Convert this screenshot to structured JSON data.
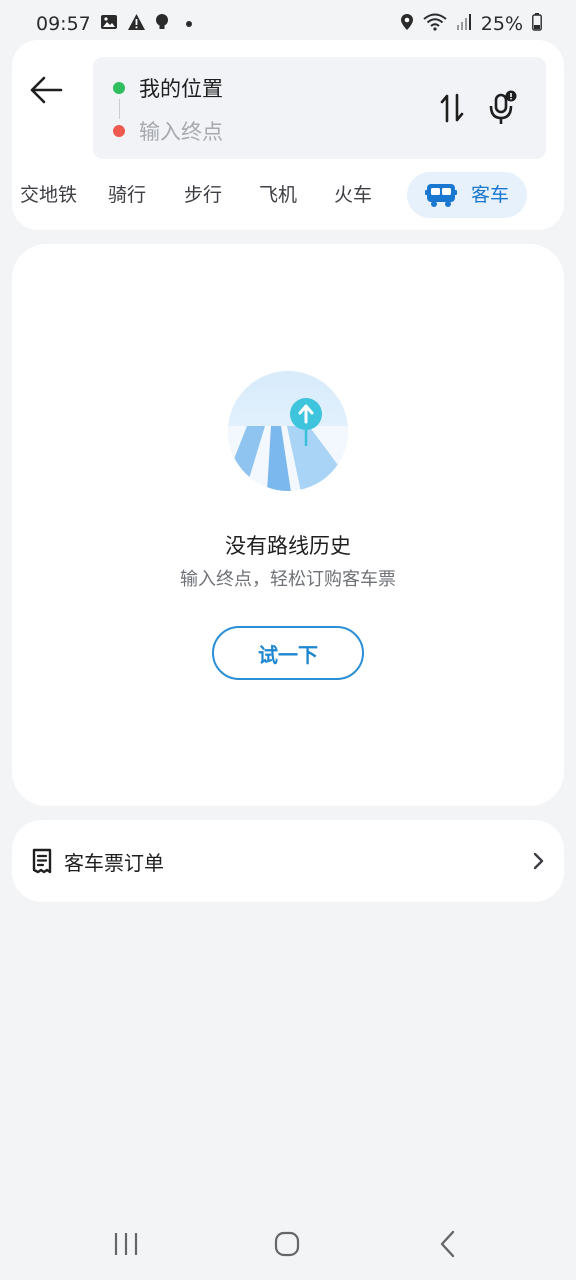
{
  "status": {
    "time": "09:57",
    "battery": "25%",
    "icons": [
      "image-icon",
      "warning-icon",
      "bulb-icon",
      "dot-icon",
      "location-icon",
      "wifi-icon",
      "signal-icon",
      "battery-icon"
    ]
  },
  "route": {
    "from": "我的位置",
    "to_placeholder": "输入终点"
  },
  "tabs": [
    {
      "label": "交地铁",
      "active": false
    },
    {
      "label": "骑行",
      "active": false
    },
    {
      "label": "步行",
      "active": false
    },
    {
      "label": "飞机",
      "active": false
    },
    {
      "label": "火车",
      "active": false
    },
    {
      "label": "客车",
      "active": true,
      "icon": "bus-icon"
    }
  ],
  "empty": {
    "title": "没有路线历史",
    "subtitle": "输入终点，轻松订购客车票",
    "button": "试一下"
  },
  "orders": {
    "label": "客车票订单",
    "icon": "ticket-icon"
  },
  "colors": {
    "accent": "#1f86d0",
    "active_tab_bg": "#e6f1fb",
    "from_dot": "#2fbf5f",
    "to_dot": "#ee5a4f",
    "page_bg": "#f3f4f6"
  }
}
